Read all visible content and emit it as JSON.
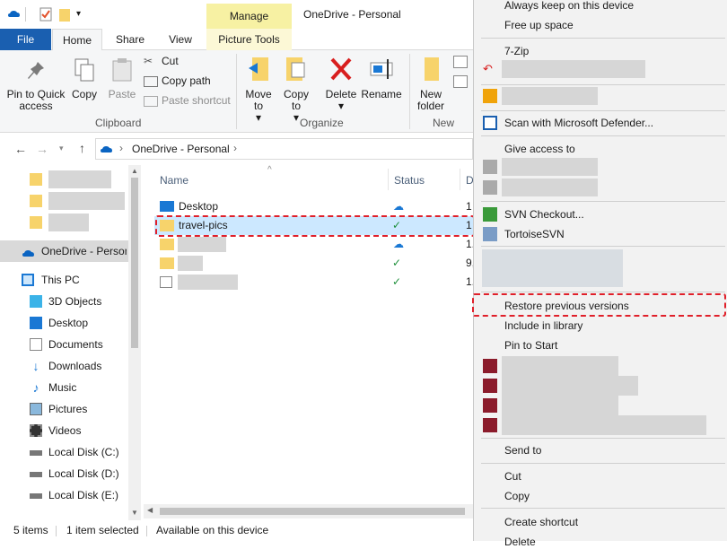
{
  "window": {
    "title": "OneDrive - Personal",
    "manage_tab": "Manage"
  },
  "tabs": {
    "file": "File",
    "home": "Home",
    "share": "Share",
    "view": "View",
    "picture_tools": "Picture Tools"
  },
  "ribbon": {
    "pin_to_quick_access": "Pin to Quick access",
    "copy": "Copy",
    "paste": "Paste",
    "cut": "Cut",
    "copy_path": "Copy path",
    "paste_shortcut": "Paste shortcut",
    "clipboard_group": "Clipboard",
    "move_to": "Move to",
    "copy_to": "Copy to",
    "delete": "Delete",
    "rename": "Rename",
    "organize_group": "Organize",
    "new_folder": "New folder",
    "new_group": "New"
  },
  "address": {
    "path": "OneDrive - Personal"
  },
  "nav": {
    "onedrive": "OneDrive - Personal",
    "this_pc": "This PC",
    "items": [
      "3D Objects",
      "Desktop",
      "Documents",
      "Downloads",
      "Music",
      "Pictures",
      "Videos",
      "Local Disk (C:)",
      "Local Disk (D:)",
      "Local Disk (E:)"
    ]
  },
  "list": {
    "col_name": "Name",
    "col_status": "Status",
    "col_date": "D",
    "rows": [
      {
        "name": "Desktop",
        "date": "1"
      },
      {
        "name": "travel-pics",
        "date": "1"
      },
      {
        "name": "",
        "date": "1."
      },
      {
        "name": "",
        "date": "9,"
      },
      {
        "name": "",
        "date": "1."
      }
    ]
  },
  "status": {
    "count": "5 items",
    "selected": "1 item selected",
    "availability": "Available on this device"
  },
  "context_menu": {
    "always_keep": "Always keep on this device",
    "free_up": "Free up space",
    "seven_zip": "7-Zip",
    "defender": "Scan with Microsoft Defender...",
    "give_access": "Give access to",
    "svn_checkout": "SVN Checkout...",
    "tortoise": "TortoiseSVN",
    "restore": "Restore previous versions",
    "include_library": "Include in library",
    "pin_start": "Pin to Start",
    "send_to": "Send to",
    "cut": "Cut",
    "copy": "Copy",
    "create_shortcut": "Create shortcut",
    "delete": "Delete"
  },
  "colors": {
    "accent": "#1a5fb0",
    "manage": "#f7f1a3",
    "highlight": "#e0202a",
    "selected_row": "#cce8ff"
  }
}
